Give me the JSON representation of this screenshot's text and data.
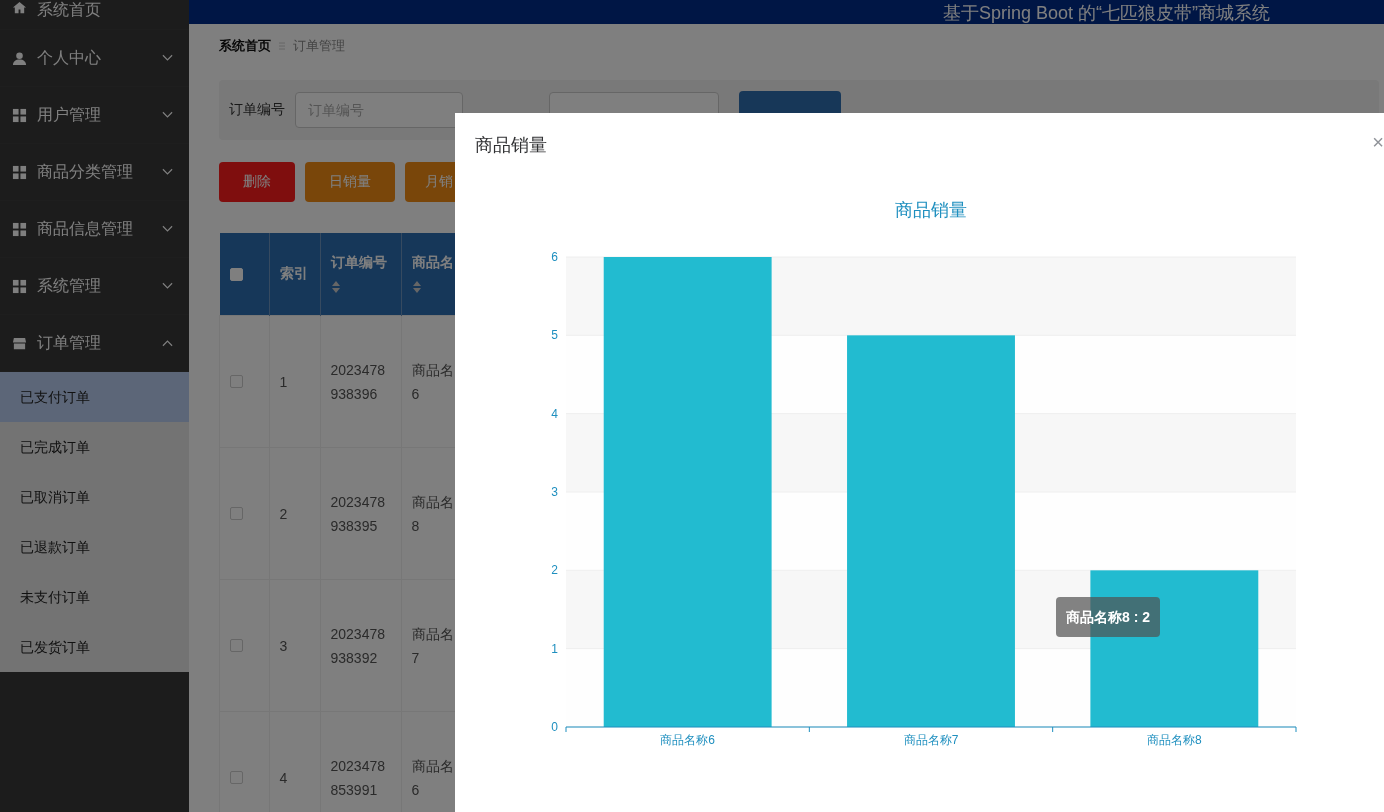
{
  "header": {
    "title": "基于Spring Boot 的“七匹狼皮带”商城系统"
  },
  "sidebar": {
    "items": [
      {
        "label": "系统首页",
        "kind": "home"
      },
      {
        "label": "个人中心",
        "kind": "person",
        "expanded": false
      },
      {
        "label": "用户管理",
        "kind": "grid",
        "expanded": false
      },
      {
        "label": "商品分类管理",
        "kind": "grid",
        "expanded": false
      },
      {
        "label": "商品信息管理",
        "kind": "grid",
        "expanded": false
      },
      {
        "label": "系统管理",
        "kind": "grid",
        "expanded": false
      },
      {
        "label": "订单管理",
        "kind": "store",
        "expanded": true,
        "children": [
          {
            "label": "已支付订单",
            "selected": true
          },
          {
            "label": "已完成订单",
            "selected": false
          },
          {
            "label": "已取消订单",
            "selected": false
          },
          {
            "label": "已退款订单",
            "selected": false
          },
          {
            "label": "未支付订单",
            "selected": false
          },
          {
            "label": "已发货订单",
            "selected": false
          }
        ]
      }
    ]
  },
  "breadcrumb": [
    "系统首页",
    "订单管理"
  ],
  "search": {
    "label": "订单编号",
    "placeholder": "订单编号"
  },
  "buttons": [
    {
      "label": "删除",
      "kind": "danger"
    },
    {
      "label": "日销量",
      "kind": "warning"
    },
    {
      "label": "月销",
      "kind": "warning"
    }
  ],
  "table": {
    "select_all": {
      "checked": false
    },
    "columns": [
      {
        "label": "索引",
        "sortable": false
      },
      {
        "label": "订单编号",
        "sortable": true
      },
      {
        "label": "商品名",
        "sortable": true
      }
    ],
    "rows": [
      {
        "checked": false,
        "cells": [
          "1",
          "2023478\n938396",
          "商品名\n6"
        ]
      },
      {
        "checked": false,
        "cells": [
          "2",
          "2023478\n938395",
          "商品名\n8"
        ]
      },
      {
        "checked": false,
        "cells": [
          "3",
          "2023478\n938392",
          "商品名\n7"
        ]
      },
      {
        "checked": false,
        "cells": [
          "4",
          "2023478\n853991",
          "商品名\n6"
        ]
      }
    ]
  },
  "dialog": {
    "title": "商品销量",
    "close": "×",
    "chart_data": {
      "type": "bar",
      "title": "商品销量",
      "categories": [
        "商品名称6",
        "商品名称7",
        "商品名称8"
      ],
      "series": [
        {
          "color": "#22bbd0",
          "values": [
            6,
            5,
            2
          ]
        }
      ],
      "ylim": [
        0,
        6
      ],
      "yticks": [
        0,
        1,
        2,
        3,
        4,
        5,
        6
      ],
      "grid": true
    },
    "tooltip": "商品名称8 : 2"
  }
}
